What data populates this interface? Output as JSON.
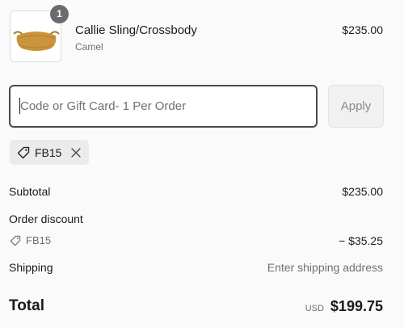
{
  "product": {
    "quantity": "1",
    "name": "Callie Sling/Crossbody",
    "variant": "Camel",
    "price": "$235.00",
    "image_icon": "bag-thumbnail-icon"
  },
  "discount": {
    "placeholder": "Code or Gift Card- 1 Per Order",
    "value": "",
    "apply_label": "Apply",
    "applied_code": "FB15"
  },
  "summary": {
    "subtotal_label": "Subtotal",
    "subtotal_value": "$235.00",
    "order_discount_label": "Order discount",
    "discount_code": "FB15",
    "discount_value": "− $35.25",
    "shipping_label": "Shipping",
    "shipping_value": "Enter shipping address",
    "total_label": "Total",
    "currency": "USD",
    "total_value": "$199.75"
  },
  "colors": {
    "bag": "#c9943a",
    "badge": "#6b6b6b",
    "input_border": "#4a4a4a",
    "chip_bg": "#ebebeb"
  }
}
